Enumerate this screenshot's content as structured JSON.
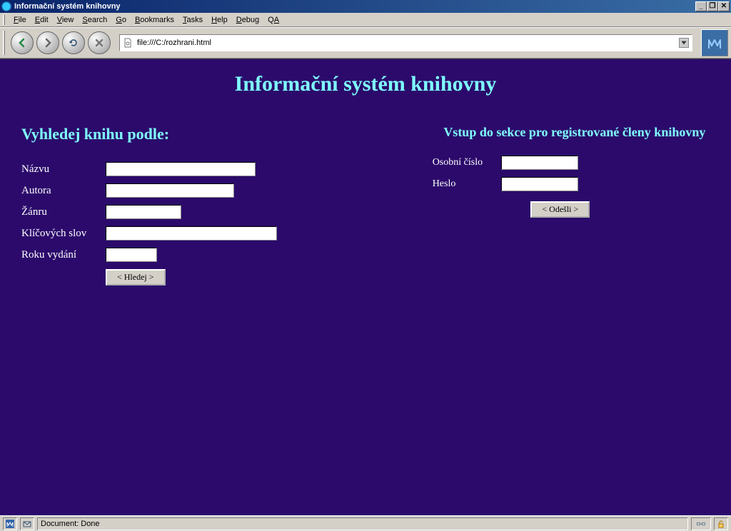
{
  "window": {
    "title": "Informační systém knihovny"
  },
  "menu": {
    "items": [
      "File",
      "Edit",
      "View",
      "Search",
      "Go",
      "Bookmarks",
      "Tasks",
      "Help",
      "Debug",
      "QA"
    ]
  },
  "address": {
    "url": "file:///C:/rozhrani.html"
  },
  "page": {
    "title": "Informační systém knihovny",
    "search": {
      "heading": "Vyhledej knihu podle:",
      "fields": {
        "name": "Názvu",
        "author": "Autora",
        "genre": "Žánru",
        "keywords": "Klíčových slov",
        "year": "Roku vydání"
      },
      "submit": "< Hledej >"
    },
    "login": {
      "heading": "Vstup do sekce pro registrované členy knihovny",
      "id_label": "Osobní číslo",
      "password_label": "Heslo",
      "submit": "< Odešli >"
    }
  },
  "status": {
    "text": "Document: Done"
  }
}
